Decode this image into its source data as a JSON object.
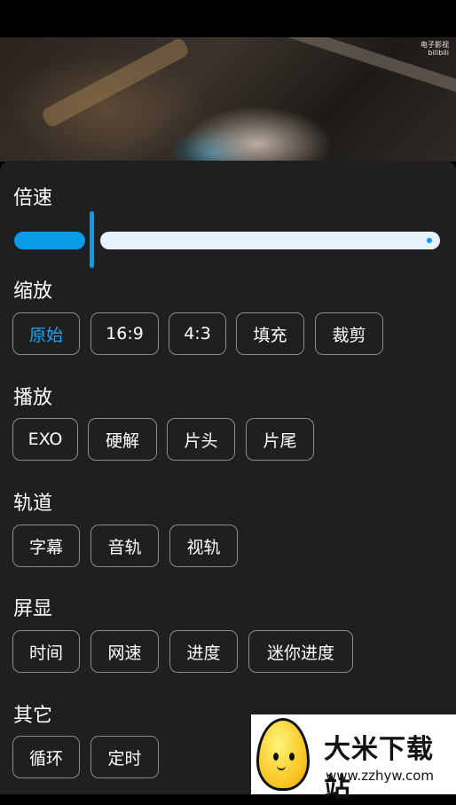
{
  "video": {
    "watermark_line1": "电子影视",
    "watermark_line2": "bilibili"
  },
  "sections": {
    "speed": {
      "title": "倍速",
      "value_fraction": 0.2
    },
    "zoom": {
      "title": "缩放",
      "options": [
        "原始",
        "16:9",
        "4:3",
        "填充",
        "裁剪"
      ],
      "selected": "原始"
    },
    "playback": {
      "title": "播放",
      "options": [
        "EXO",
        "硬解",
        "片头",
        "片尾"
      ]
    },
    "track": {
      "title": "轨道",
      "options": [
        "字幕",
        "音轨",
        "视轨"
      ]
    },
    "screen": {
      "title": "屏显",
      "options": [
        "时间",
        "网速",
        "进度",
        "迷你进度"
      ]
    },
    "other": {
      "title": "其它",
      "options": [
        "循环",
        "定时"
      ]
    }
  },
  "brand": {
    "name": "大米下载站",
    "url": "www.zzhyw.com"
  },
  "colors": {
    "accent": "#0a9be8",
    "panel_bg": "#1f1f21",
    "chip_border": "#8a8a8d"
  }
}
